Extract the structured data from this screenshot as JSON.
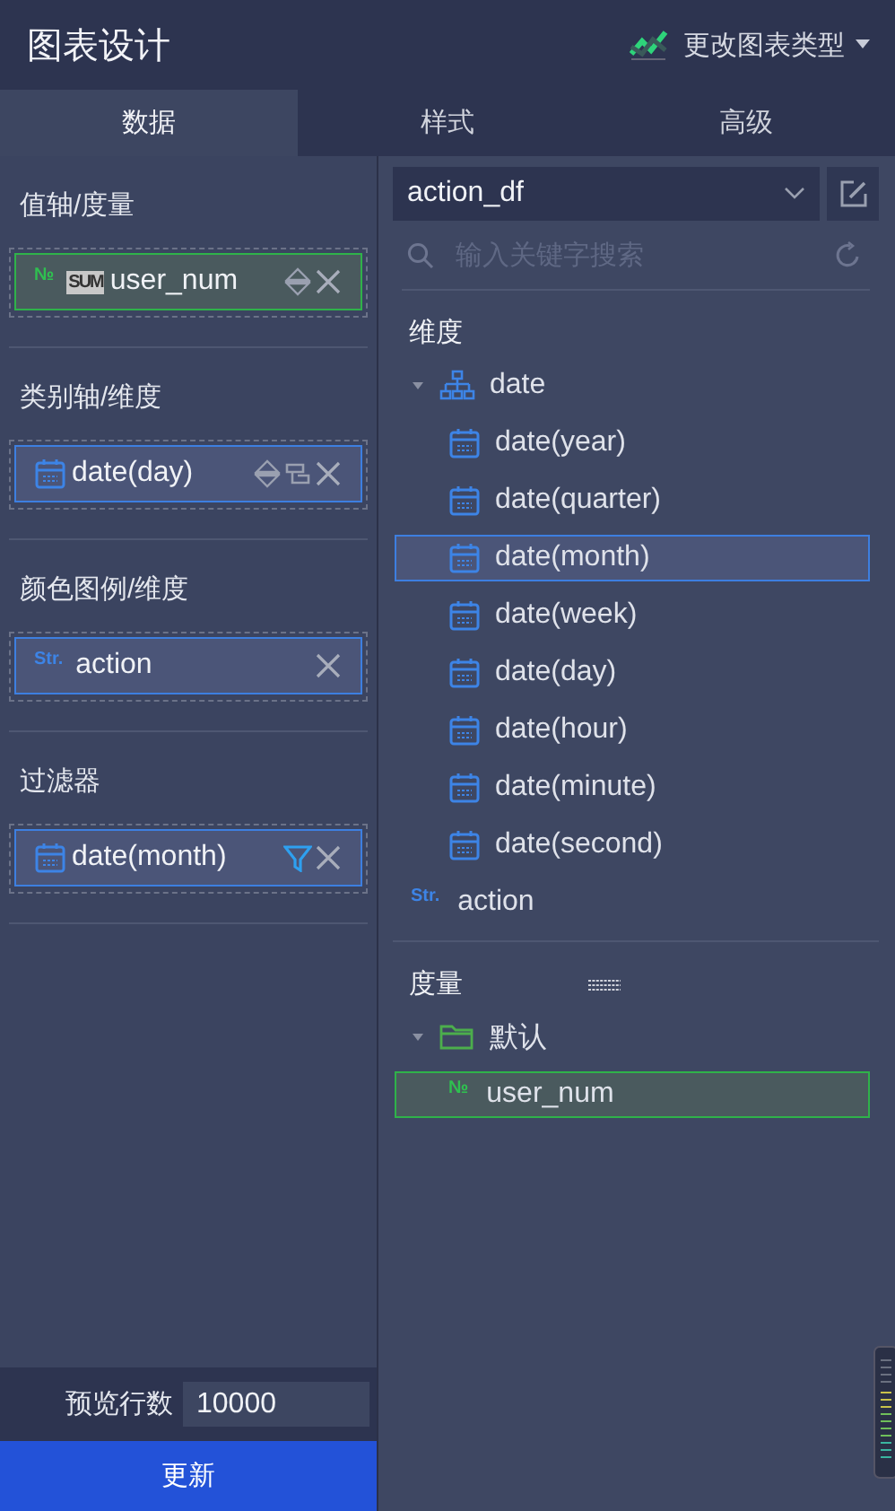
{
  "header": {
    "title": "图表设计",
    "chart_type_button": "更改图表类型"
  },
  "tabs": [
    {
      "label": "数据",
      "selected": true
    },
    {
      "label": "样式",
      "selected": false
    },
    {
      "label": "高级",
      "selected": false
    }
  ],
  "sections": [
    {
      "title": "值轴/度量",
      "fields": [
        {
          "kind": "number",
          "type_label": "№",
          "badge": "SUM",
          "label": "user_num",
          "actions": [
            {
              "kind": "sort"
            },
            {
              "kind": "remove"
            }
          ]
        }
      ]
    },
    {
      "title": "类别轴/维度",
      "fields": [
        {
          "kind": "date",
          "label": "date(day)",
          "actions": [
            {
              "kind": "sort"
            },
            {
              "kind": "group"
            },
            {
              "kind": "remove"
            }
          ]
        }
      ]
    },
    {
      "title": "颜色图例/维度",
      "fields": [
        {
          "kind": "string",
          "type_label": "Str.",
          "label": "action",
          "actions": [
            {
              "kind": "remove"
            }
          ]
        }
      ]
    },
    {
      "title": "过滤器",
      "fields": [
        {
          "kind": "date",
          "label": "date(month)",
          "actions": [
            {
              "kind": "filter"
            },
            {
              "kind": "remove"
            }
          ]
        }
      ]
    }
  ],
  "preview": {
    "label": "预览行数",
    "value": "10000"
  },
  "update_button": "更新",
  "dataset": {
    "value": "action_df"
  },
  "search": {
    "placeholder": "输入关键字搜索"
  },
  "dimensions": {
    "title": "维度",
    "items": [
      {
        "kind": "hierarchy",
        "label": "date",
        "expanded": true,
        "selected": false,
        "children": [
          {
            "kind": "date",
            "label": "date(year)",
            "selected": false
          },
          {
            "kind": "date",
            "label": "date(quarter)",
            "selected": false
          },
          {
            "kind": "date",
            "label": "date(month)",
            "selected": true
          },
          {
            "kind": "date",
            "label": "date(week)",
            "selected": false
          },
          {
            "kind": "date",
            "label": "date(day)",
            "selected": false
          },
          {
            "kind": "date",
            "label": "date(hour)",
            "selected": false
          },
          {
            "kind": "date",
            "label": "date(minute)",
            "selected": false
          },
          {
            "kind": "date",
            "label": "date(second)",
            "selected": false
          }
        ]
      },
      {
        "kind": "string",
        "type_label": "Str.",
        "label": "action",
        "selected": false
      }
    ]
  },
  "measures": {
    "title": "度量",
    "items": [
      {
        "kind": "folder",
        "label": "默认",
        "expanded": true,
        "selected": false,
        "children": [
          {
            "kind": "number",
            "type_label": "№",
            "label": "user_num",
            "selected": true
          }
        ]
      }
    ]
  }
}
